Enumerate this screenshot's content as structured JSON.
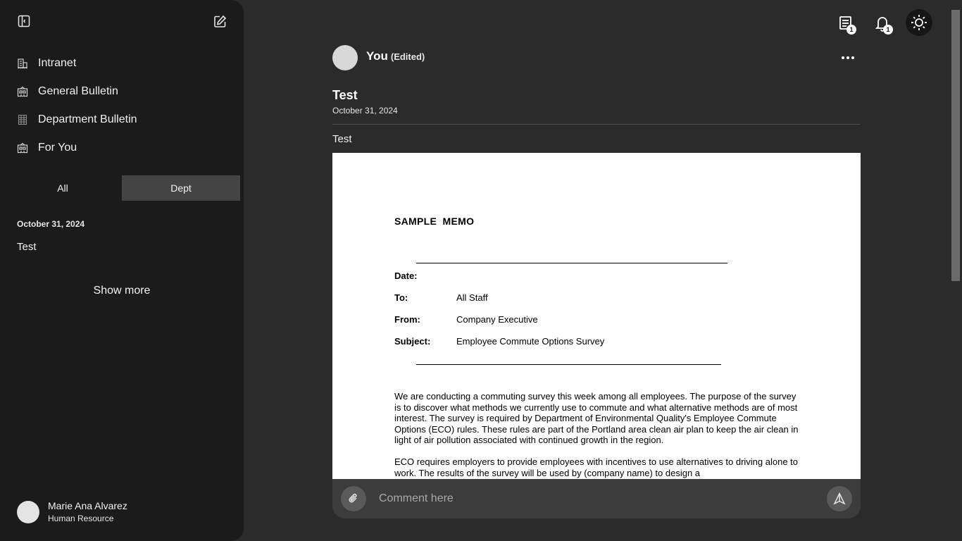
{
  "sidebar": {
    "nav": [
      {
        "label": "Intranet",
        "icon": "building-icon"
      },
      {
        "label": "General Bulletin",
        "icon": "bulletin-board-icon"
      },
      {
        "label": "Department Bulletin",
        "icon": "grid-building-icon"
      },
      {
        "label": "For You",
        "icon": "bulletin-board-icon"
      }
    ],
    "tabs": [
      {
        "label": "All",
        "active": false
      },
      {
        "label": "Dept",
        "active": true
      }
    ],
    "date": "October 31, 2024",
    "post_title": "Test",
    "show_more": "Show more",
    "user": {
      "name": "Marie Ana Alvarez",
      "role": "Human Resource"
    }
  },
  "header": {
    "messages_badge": "1",
    "notifications_badge": "1"
  },
  "post": {
    "author": "You",
    "edited": "(Edited)",
    "title": "Test",
    "date": "October 31, 2024",
    "body": "Test",
    "attachment": {
      "heading": "SAMPLE  MEMO",
      "date_label": "Date:",
      "to_label": "To:",
      "to_value": "All Staff",
      "from_label": "From:",
      "from_value": "Company Executive",
      "subject_label": "Subject:",
      "subject_value": "Employee Commute Options Survey",
      "para1": "We are conducting a commuting survey this week among all employees.  The purpose of the survey is to discover what methods we currently use to commute and what alternative methods are of most interest.  The survey is required by Department of Environmental Quality's Employee Commute Options (ECO) rules.  These rules are part of the Portland area clean air plan to keep the air clean in light of air pollution associated with continued growth in the region.",
      "para2": "ECO requires employers to provide employees with incentives to use alternatives to driving alone to work.  The results of the survey will be used by (company name) to design a"
    }
  },
  "comment": {
    "placeholder": "Comment here"
  }
}
